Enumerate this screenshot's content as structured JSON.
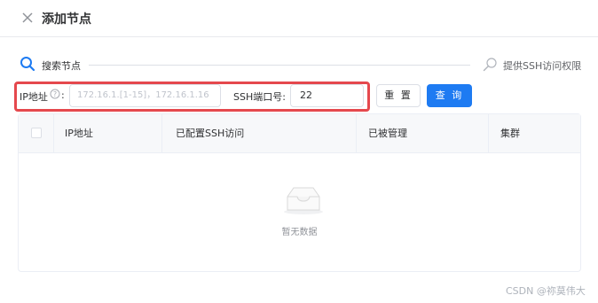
{
  "dialog": {
    "title": "添加节点"
  },
  "search": {
    "label": "搜索节点"
  },
  "ssh": {
    "link": "提供SSH访问权限"
  },
  "form": {
    "ip_label": "IP地址",
    "colon": ":",
    "ip_placeholder": "172.16.1.[1-15]，172.16.1.16",
    "port_label": "SSH端口号:",
    "port_value": "22",
    "reset_label": "重 置",
    "query_label": "查 询"
  },
  "table": {
    "columns": [
      "IP地址",
      "已配置SSH访问",
      "已被管理",
      "集群"
    ],
    "empty_text": "暂无数据"
  },
  "watermark": "CSDN @祢莫伟大",
  "colors": {
    "primary": "#1e7bf2",
    "highlight": "#e5484d"
  }
}
